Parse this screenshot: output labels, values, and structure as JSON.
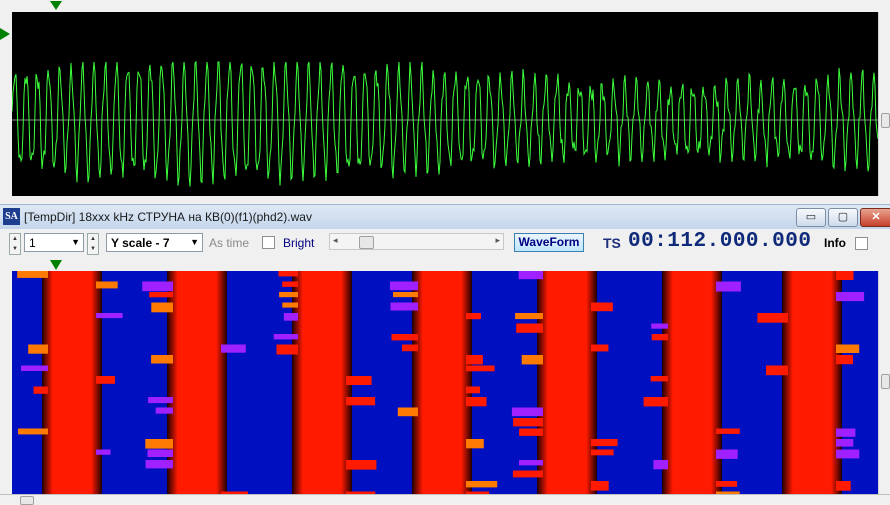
{
  "top_panel": {
    "waveform": {
      "centerline_color": "#8a8a8a",
      "trace_color": "#3cff3c",
      "marker_color": "#008000"
    }
  },
  "window": {
    "title": "[TempDir] 18xxx kHz СТРУНА на КВ(0)(f1)(phd2).wav",
    "icon_text": "SA",
    "minimize_glyph": "▭",
    "maximize_glyph": "▢",
    "close_glyph": "✕"
  },
  "toolbar": {
    "channel_value": "1",
    "yscale_value": "Y scale - 7",
    "as_time_label": "As time",
    "bright_label": "Bright",
    "waveform_button": "WaveForm",
    "ts_label": "TS",
    "ts_value": "00:112.000.000",
    "info_label": "Info"
  },
  "spectrogram": {
    "colors": {
      "background": "#0010c0",
      "red": "#ff1a00",
      "dark": "#200000",
      "orange": "#ff7a00",
      "magenta": "#a020ff"
    }
  }
}
